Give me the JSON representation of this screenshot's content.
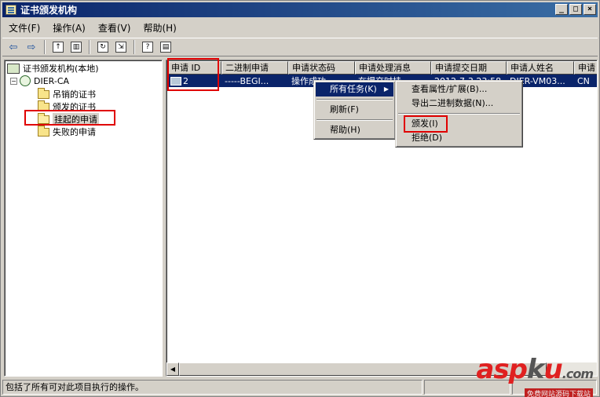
{
  "window": {
    "title": "证书颁发机构"
  },
  "title_buttons": {
    "minimize": "_",
    "maximize": "□",
    "close": "×"
  },
  "menu": [
    "文件(F)",
    "操作(A)",
    "查看(V)",
    "帮助(H)"
  ],
  "tree": {
    "root": "证书颁发机构(本地)",
    "ca": "DIER-CA",
    "expander": "−",
    "items": [
      "吊销的证书",
      "颁发的证书",
      "挂起的申请",
      "失败的申请"
    ]
  },
  "list": {
    "columns": [
      "申请 ID",
      "二进制申请",
      "申请状态码",
      "申请处理消息",
      "申请提交日期",
      "申请人姓名",
      "申请"
    ],
    "rows": [
      {
        "cells": [
          "2",
          "-----BEGI...",
          "操作成功...",
          "在提交时挂...",
          "2012-7-3 23:58",
          "DIER-VM03...",
          "CN"
        ]
      }
    ]
  },
  "context_menu": {
    "items": [
      "所有任务(K)",
      "刷新(F)",
      "帮助(H)"
    ]
  },
  "submenu": {
    "items": [
      "查看属性/扩展(B)...",
      "导出二进制数据(N)...",
      "颁发(I)",
      "拒绝(D)"
    ]
  },
  "status": {
    "text": "包括了所有可对此项目执行的操作。"
  },
  "watermark": {
    "part1": "asp",
    "part2": "k",
    "part3": "u",
    "tld": ".com",
    "caption": "免费网站源码下载站"
  },
  "colors": {
    "selection": "#0a246a",
    "highlight_box": "#e00000",
    "window_face": "#d4d0c8"
  }
}
